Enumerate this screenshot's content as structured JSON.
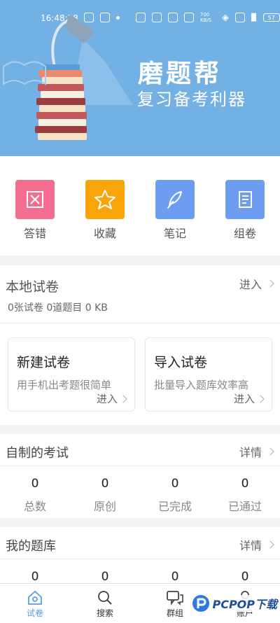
{
  "status_bar": {
    "time": "16:48:38",
    "speed": "700 KB/S",
    "battery": "57"
  },
  "banner": {
    "title": "磨题帮",
    "subtitle": "复习备考利器"
  },
  "quick_actions": [
    {
      "label": "答错",
      "icon": "wrong-answer-icon",
      "color": "#f36e8f"
    },
    {
      "label": "收藏",
      "icon": "star-icon",
      "color": "#f9a40b"
    },
    {
      "label": "笔记",
      "icon": "feather-icon",
      "color": "#6d9cf0"
    },
    {
      "label": "组卷",
      "icon": "paper-scroll-icon",
      "color": "#6d9cf0"
    }
  ],
  "local_papers": {
    "title": "本地试卷",
    "enter": "进入",
    "summary": "0张试卷 0道题目 0 KB",
    "new_paper": {
      "title": "新建试卷",
      "desc": "用手机出考题很简单",
      "enter": "进入"
    },
    "import_paper": {
      "title": "导入试卷",
      "desc": "批量导入题库效率高",
      "enter": "进入"
    }
  },
  "my_exams": {
    "title": "自制的考试",
    "more": "详情",
    "stats": [
      {
        "value": "0",
        "label": "总数"
      },
      {
        "value": "0",
        "label": "原创"
      },
      {
        "value": "0",
        "label": "已完成"
      },
      {
        "value": "0",
        "label": "已通过"
      }
    ]
  },
  "my_banks": {
    "title": "我的题库",
    "more": "详情",
    "stats": [
      {
        "value": "0"
      },
      {
        "value": "0"
      },
      {
        "value": "0"
      },
      {
        "value": "0"
      }
    ]
  },
  "tabbar": [
    {
      "label": "试卷",
      "icon": "home-icon",
      "active": true
    },
    {
      "label": "搜索",
      "icon": "search-icon"
    },
    {
      "label": "群组",
      "icon": "chat-icon"
    },
    {
      "label": "账户",
      "icon": "user-icon"
    }
  ],
  "watermark": {
    "text": "PCPOP下载"
  },
  "accent_color": "#5a9ee8"
}
